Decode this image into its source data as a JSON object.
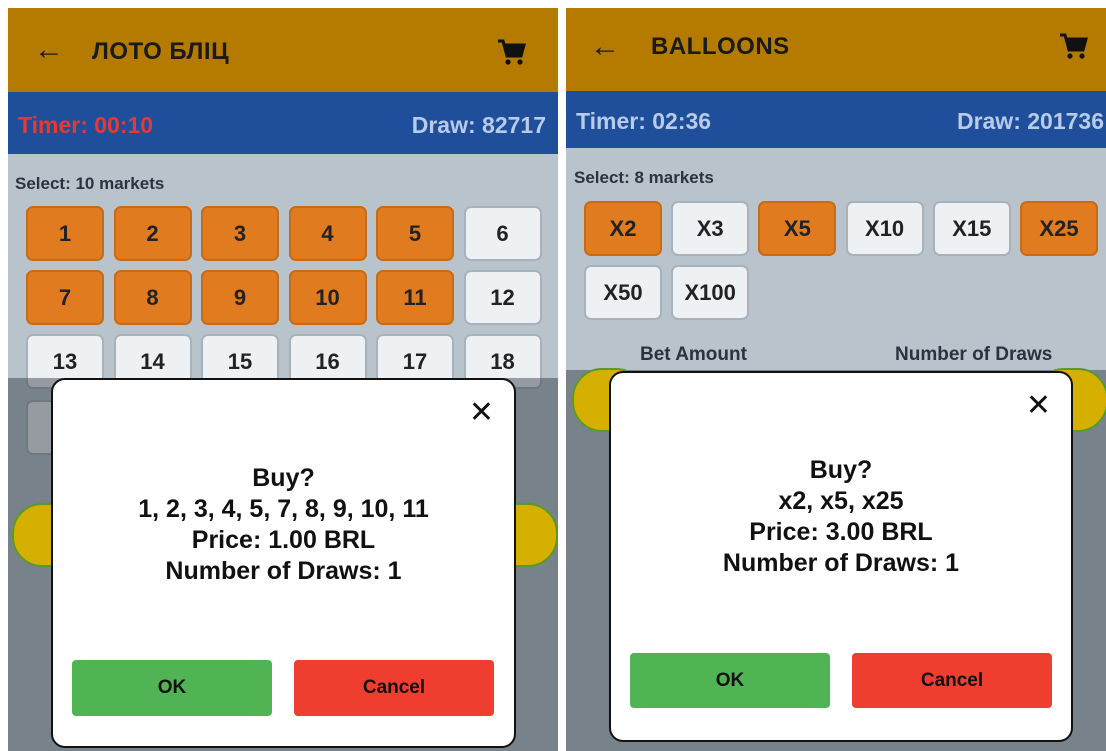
{
  "screens": [
    {
      "header": {
        "back_icon": "arrow-left-icon",
        "title": "ЛОТО БЛІЦ",
        "cart_icon": "cart-icon"
      },
      "info": {
        "timer": "Timer: 00:10",
        "draw": "Draw: 82717",
        "timer_color": "#e53935"
      },
      "select_label": "Select: 10 markets",
      "markets": [
        {
          "label": "1",
          "selected": true
        },
        {
          "label": "2",
          "selected": true
        },
        {
          "label": "3",
          "selected": true
        },
        {
          "label": "4",
          "selected": true
        },
        {
          "label": "5",
          "selected": true
        },
        {
          "label": "6",
          "selected": false
        },
        {
          "label": "7",
          "selected": true
        },
        {
          "label": "8",
          "selected": true
        },
        {
          "label": "9",
          "selected": true
        },
        {
          "label": "10",
          "selected": true
        },
        {
          "label": "11",
          "selected": true
        },
        {
          "label": "12",
          "selected": false
        },
        {
          "label": "13",
          "selected": false
        },
        {
          "label": "14",
          "selected": false
        },
        {
          "label": "15",
          "selected": false
        },
        {
          "label": "16",
          "selected": false
        },
        {
          "label": "17",
          "selected": false
        },
        {
          "label": "18",
          "selected": false
        }
      ],
      "dialog": {
        "close_icon": "close-icon",
        "title": "Buy?",
        "selection": "1, 2, 3, 4, 5, 7, 8, 9, 10, 11",
        "price": "Price: 1.00 BRL",
        "draws": "Number of Draws: 1",
        "ok_label": "OK",
        "cancel_label": "Cancel"
      }
    },
    {
      "header": {
        "back_icon": "arrow-left-icon",
        "title": "BALLOONS",
        "cart_icon": "cart-icon"
      },
      "info": {
        "timer": "Timer: 02:36",
        "draw": "Draw: 201736",
        "timer_color": "#b8cbe8"
      },
      "select_label": "Select: 8 markets",
      "markets": [
        {
          "label": "X2",
          "selected": true
        },
        {
          "label": "X3",
          "selected": false
        },
        {
          "label": "X5",
          "selected": true
        },
        {
          "label": "X10",
          "selected": false
        },
        {
          "label": "X15",
          "selected": false
        },
        {
          "label": "X25",
          "selected": true
        },
        {
          "label": "X50",
          "selected": false
        },
        {
          "label": "X100",
          "selected": false
        }
      ],
      "bet_amount_label": "Bet Amount",
      "number_of_draws_label": "Number of Draws",
      "dialog": {
        "close_icon": "close-icon",
        "title": "Buy?",
        "selection": "x2, x5, x25",
        "price": "Price: 3.00 BRL",
        "draws": "Number of Draws: 1",
        "ok_label": "OK",
        "cancel_label": "Cancel"
      }
    }
  ],
  "colors": {
    "header_bg": "#b57b00",
    "info_bg": "#1f4f9a",
    "selected_market": "#e07b20",
    "ok_button": "#50b454",
    "cancel_button": "#ef3e2f"
  }
}
